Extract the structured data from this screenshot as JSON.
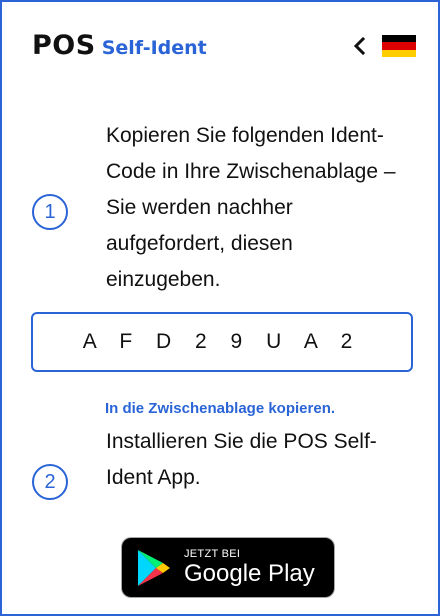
{
  "header": {
    "brand": "POS",
    "subtitle": "Self-Ident",
    "back_icon": "chevron-left-icon",
    "flag_icon": "german-flag-icon"
  },
  "step1": {
    "number": "1",
    "text": "Kopieren Sie folgenden Ident-Code in Ihre Zwischenablage – Sie werden nachher aufgefordert, diesen einzugeben."
  },
  "ident_code": "A F D 2 9 U A 2",
  "copy_link": "In die Zwischenablage kopieren.",
  "step2": {
    "number": "2",
    "text": "Installieren Sie die POS Self-Ident App."
  },
  "store_badge": {
    "small": "JETZT BEI",
    "big": "Google Play",
    "icon": "google-play-icon"
  },
  "colors": {
    "accent": "#2a64d6",
    "text": "#111111"
  }
}
